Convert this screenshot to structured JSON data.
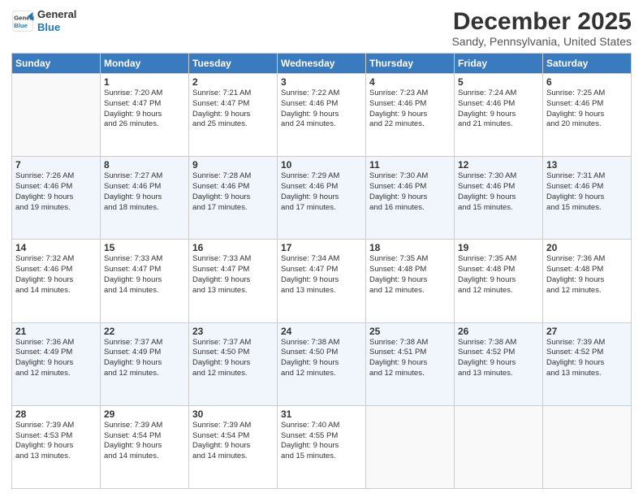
{
  "logo": {
    "line1": "General",
    "line2": "Blue"
  },
  "title": "December 2025",
  "subtitle": "Sandy, Pennsylvania, United States",
  "weekdays": [
    "Sunday",
    "Monday",
    "Tuesday",
    "Wednesday",
    "Thursday",
    "Friday",
    "Saturday"
  ],
  "weeks": [
    [
      {
        "day": "",
        "empty": true
      },
      {
        "day": "1",
        "sunrise": "7:20 AM",
        "sunset": "4:47 PM",
        "daylight": "9 hours and 26 minutes."
      },
      {
        "day": "2",
        "sunrise": "7:21 AM",
        "sunset": "4:47 PM",
        "daylight": "9 hours and 25 minutes."
      },
      {
        "day": "3",
        "sunrise": "7:22 AM",
        "sunset": "4:46 PM",
        "daylight": "9 hours and 24 minutes."
      },
      {
        "day": "4",
        "sunrise": "7:23 AM",
        "sunset": "4:46 PM",
        "daylight": "9 hours and 22 minutes."
      },
      {
        "day": "5",
        "sunrise": "7:24 AM",
        "sunset": "4:46 PM",
        "daylight": "9 hours and 21 minutes."
      },
      {
        "day": "6",
        "sunrise": "7:25 AM",
        "sunset": "4:46 PM",
        "daylight": "9 hours and 20 minutes."
      }
    ],
    [
      {
        "day": "7",
        "sunrise": "7:26 AM",
        "sunset": "4:46 PM",
        "daylight": "9 hours and 19 minutes."
      },
      {
        "day": "8",
        "sunrise": "7:27 AM",
        "sunset": "4:46 PM",
        "daylight": "9 hours and 18 minutes."
      },
      {
        "day": "9",
        "sunrise": "7:28 AM",
        "sunset": "4:46 PM",
        "daylight": "9 hours and 17 minutes."
      },
      {
        "day": "10",
        "sunrise": "7:29 AM",
        "sunset": "4:46 PM",
        "daylight": "9 hours and 17 minutes."
      },
      {
        "day": "11",
        "sunrise": "7:30 AM",
        "sunset": "4:46 PM",
        "daylight": "9 hours and 16 minutes."
      },
      {
        "day": "12",
        "sunrise": "7:30 AM",
        "sunset": "4:46 PM",
        "daylight": "9 hours and 15 minutes."
      },
      {
        "day": "13",
        "sunrise": "7:31 AM",
        "sunset": "4:46 PM",
        "daylight": "9 hours and 15 minutes."
      }
    ],
    [
      {
        "day": "14",
        "sunrise": "7:32 AM",
        "sunset": "4:46 PM",
        "daylight": "9 hours and 14 minutes."
      },
      {
        "day": "15",
        "sunrise": "7:33 AM",
        "sunset": "4:47 PM",
        "daylight": "9 hours and 14 minutes."
      },
      {
        "day": "16",
        "sunrise": "7:33 AM",
        "sunset": "4:47 PM",
        "daylight": "9 hours and 13 minutes."
      },
      {
        "day": "17",
        "sunrise": "7:34 AM",
        "sunset": "4:47 PM",
        "daylight": "9 hours and 13 minutes."
      },
      {
        "day": "18",
        "sunrise": "7:35 AM",
        "sunset": "4:48 PM",
        "daylight": "9 hours and 12 minutes."
      },
      {
        "day": "19",
        "sunrise": "7:35 AM",
        "sunset": "4:48 PM",
        "daylight": "9 hours and 12 minutes."
      },
      {
        "day": "20",
        "sunrise": "7:36 AM",
        "sunset": "4:48 PM",
        "daylight": "9 hours and 12 minutes."
      }
    ],
    [
      {
        "day": "21",
        "sunrise": "7:36 AM",
        "sunset": "4:49 PM",
        "daylight": "9 hours and 12 minutes."
      },
      {
        "day": "22",
        "sunrise": "7:37 AM",
        "sunset": "4:49 PM",
        "daylight": "9 hours and 12 minutes."
      },
      {
        "day": "23",
        "sunrise": "7:37 AM",
        "sunset": "4:50 PM",
        "daylight": "9 hours and 12 minutes."
      },
      {
        "day": "24",
        "sunrise": "7:38 AM",
        "sunset": "4:50 PM",
        "daylight": "9 hours and 12 minutes."
      },
      {
        "day": "25",
        "sunrise": "7:38 AM",
        "sunset": "4:51 PM",
        "daylight": "9 hours and 12 minutes."
      },
      {
        "day": "26",
        "sunrise": "7:38 AM",
        "sunset": "4:52 PM",
        "daylight": "9 hours and 13 minutes."
      },
      {
        "day": "27",
        "sunrise": "7:39 AM",
        "sunset": "4:52 PM",
        "daylight": "9 hours and 13 minutes."
      }
    ],
    [
      {
        "day": "28",
        "sunrise": "7:39 AM",
        "sunset": "4:53 PM",
        "daylight": "9 hours and 13 minutes."
      },
      {
        "day": "29",
        "sunrise": "7:39 AM",
        "sunset": "4:54 PM",
        "daylight": "9 hours and 14 minutes."
      },
      {
        "day": "30",
        "sunrise": "7:39 AM",
        "sunset": "4:54 PM",
        "daylight": "9 hours and 14 minutes."
      },
      {
        "day": "31",
        "sunrise": "7:40 AM",
        "sunset": "4:55 PM",
        "daylight": "9 hours and 15 minutes."
      },
      {
        "day": "",
        "empty": true
      },
      {
        "day": "",
        "empty": true
      },
      {
        "day": "",
        "empty": true
      }
    ]
  ]
}
